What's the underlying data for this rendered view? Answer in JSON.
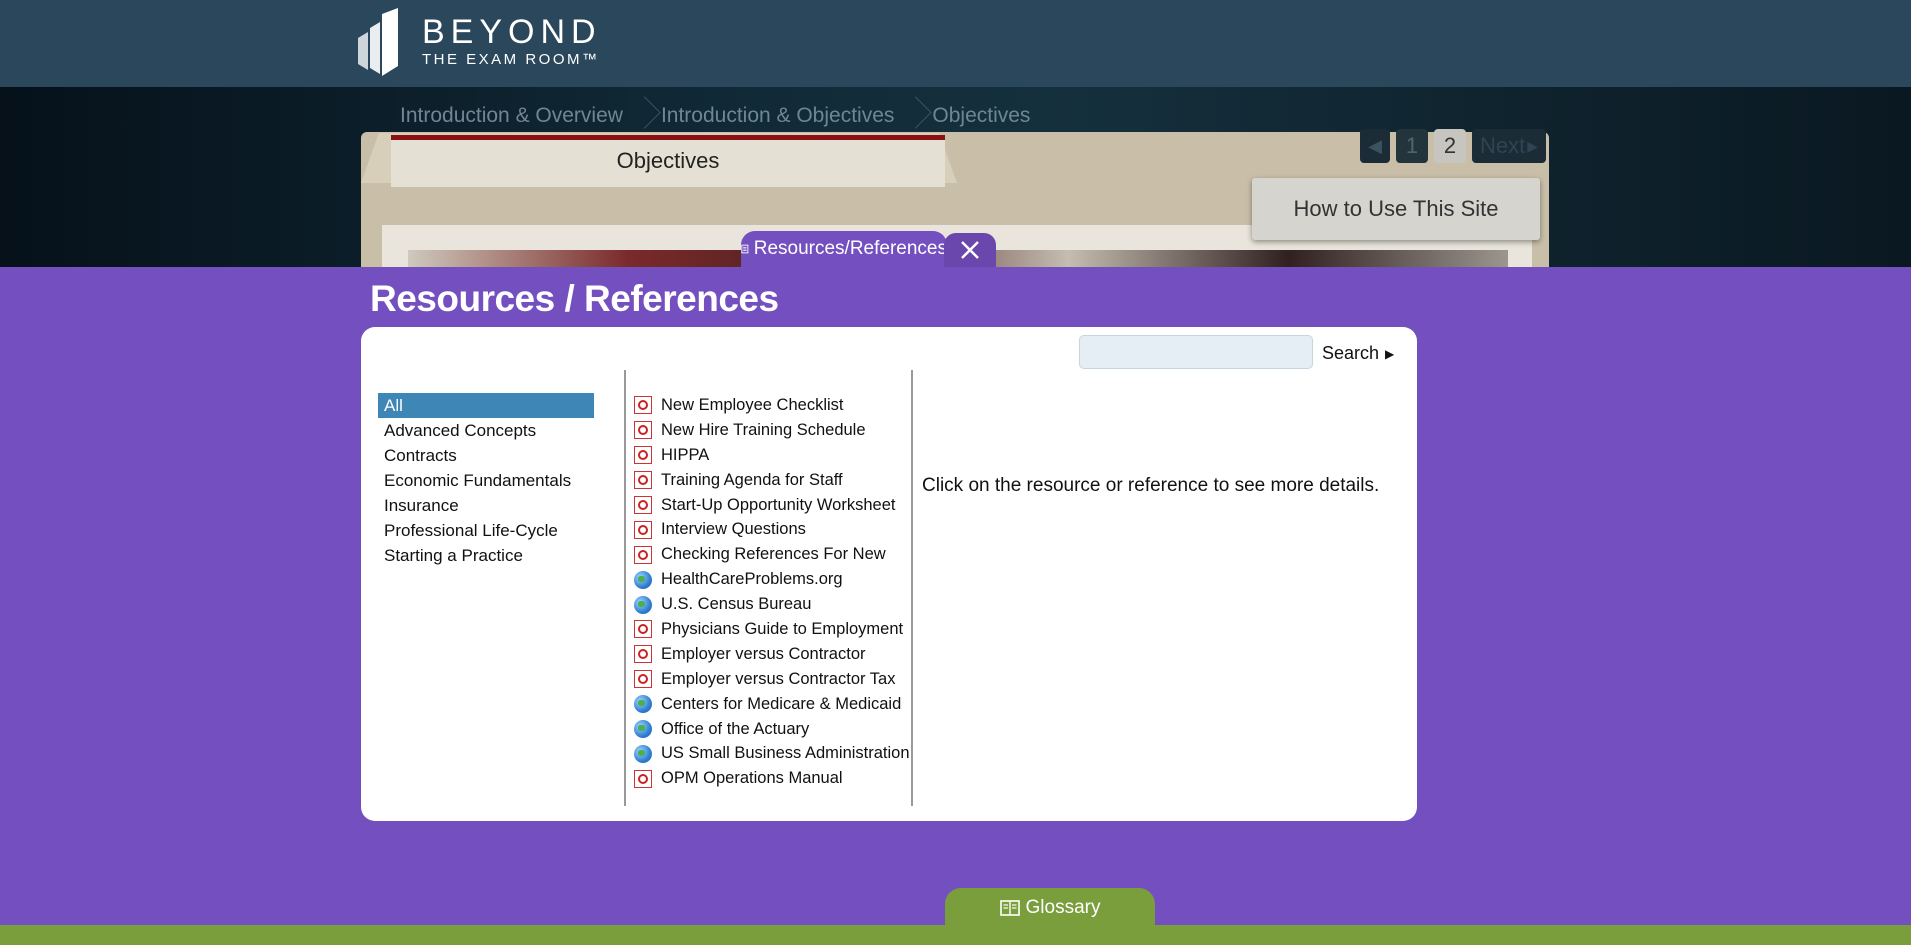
{
  "header": {
    "logo_line1": "BEYOND",
    "logo_line2": "THE EXAM ROOM™"
  },
  "breadcrumb": [
    "Introduction & Overview",
    "Introduction & Objectives",
    "Objectives"
  ],
  "section_tab_title": "Objectives",
  "pager": {
    "prev_icon": "chevron-left-icon",
    "pages": [
      "1",
      "2"
    ],
    "active_page": "2",
    "next_label": "Next"
  },
  "how_to_button": "How to Use This Site",
  "resources_tab": {
    "label": "Resources/References",
    "icon": "document-icon",
    "close_icon": "close-icon"
  },
  "page_title": "Resources / References",
  "search": {
    "placeholder": "",
    "value": "",
    "button_label": "Search"
  },
  "categories": {
    "selected": "All",
    "items": [
      "All",
      "Advanced Concepts",
      "Contracts",
      "Economic Fundamentals",
      "Insurance",
      "Professional Life-Cycle",
      "Starting a Practice"
    ]
  },
  "resources": [
    {
      "label": "New Employee Checklist",
      "icon": "pdf-icon"
    },
    {
      "label": "New Hire Training Schedule",
      "icon": "pdf-icon"
    },
    {
      "label": "HIPPA",
      "icon": "pdf-icon"
    },
    {
      "label": "Training Agenda for Staff",
      "icon": "pdf-icon"
    },
    {
      "label": "Start-Up Opportunity Worksheet",
      "icon": "pdf-icon"
    },
    {
      "label": "Interview Questions",
      "icon": "pdf-icon"
    },
    {
      "label": "Checking References For New",
      "icon": "pdf-icon"
    },
    {
      "label": "HealthCareProblems.org",
      "icon": "globe-icon"
    },
    {
      "label": "U.S. Census Bureau",
      "icon": "globe-icon"
    },
    {
      "label": "Physicians Guide to Employment",
      "icon": "pdf-icon"
    },
    {
      "label": "Employer versus Contractor",
      "icon": "pdf-icon"
    },
    {
      "label": "Employer versus Contractor Tax",
      "icon": "pdf-icon"
    },
    {
      "label": "Centers for Medicare & Medicaid",
      "icon": "globe-icon"
    },
    {
      "label": "Office of the Actuary",
      "icon": "globe-icon"
    },
    {
      "label": "US Small Business Administration",
      "icon": "globe-icon"
    },
    {
      "label": "OPM Operations Manual",
      "icon": "pdf-icon"
    }
  ],
  "detail_text": "Click on the resource or reference to see more details.",
  "glossary_tab": {
    "label": "Glossary",
    "icon": "book-icon"
  },
  "colors": {
    "header": "#2a475c",
    "panel_bg": "#744fbf",
    "selected": "#3e86b5",
    "footer": "#7b9e3d"
  }
}
